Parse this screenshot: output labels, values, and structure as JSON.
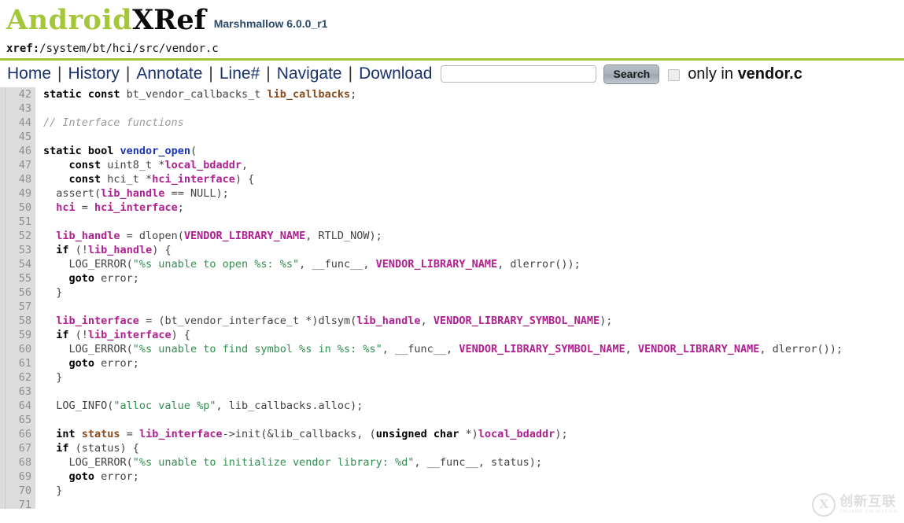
{
  "masthead": {
    "logo_part1": "Android",
    "logo_part2": "XRef",
    "version": "Marshmallow 6.0.0_r1",
    "brand_green": "#a4c639",
    "version_color": "#2c4a68"
  },
  "xref": {
    "label": "xref:",
    "path": "/system/bt/hci/src/vendor.c"
  },
  "nav": {
    "links": [
      {
        "label": "Home"
      },
      {
        "label": "History"
      },
      {
        "label": "Annotate"
      },
      {
        "label": "Line#"
      },
      {
        "label": "Navigate"
      },
      {
        "label": "Download"
      }
    ],
    "separator": "|",
    "search_value": "",
    "search_placeholder": "",
    "search_button_label": "Search",
    "only_in_prefix": "only in ",
    "only_in_file": "vendor.c",
    "only_in_checked": false
  },
  "code": {
    "first_line": 42,
    "last_line": 71,
    "lines": [
      {
        "n": "42",
        "tokens": [
          {
            "t": "kw",
            "v": "static const"
          },
          {
            "t": "pl",
            "v": " bt_vendor_callbacks_t "
          },
          {
            "t": "def",
            "v": "lib_callbacks"
          },
          {
            "t": "pl",
            "v": ";"
          }
        ]
      },
      {
        "n": "43",
        "tokens": []
      },
      {
        "n": "44",
        "tokens": [
          {
            "t": "cmt",
            "v": "// Interface functions"
          }
        ]
      },
      {
        "n": "45",
        "tokens": []
      },
      {
        "n": "46",
        "tokens": [
          {
            "t": "kw",
            "v": "static bool "
          },
          {
            "t": "fn",
            "v": "vendor_open"
          },
          {
            "t": "pl",
            "v": "("
          }
        ]
      },
      {
        "n": "47",
        "tokens": [
          {
            "t": "pl",
            "v": "    "
          },
          {
            "t": "kw",
            "v": "const"
          },
          {
            "t": "pl",
            "v": " uint8_t *"
          },
          {
            "t": "ref",
            "v": "local_bdaddr"
          },
          {
            "t": "pl",
            "v": ","
          }
        ]
      },
      {
        "n": "48",
        "tokens": [
          {
            "t": "pl",
            "v": "    "
          },
          {
            "t": "kw",
            "v": "const"
          },
          {
            "t": "pl",
            "v": " hci_t *"
          },
          {
            "t": "ref",
            "v": "hci_interface"
          },
          {
            "t": "pl",
            "v": ") {"
          }
        ]
      },
      {
        "n": "49",
        "tokens": [
          {
            "t": "pl",
            "v": "  assert("
          },
          {
            "t": "ref",
            "v": "lib_handle"
          },
          {
            "t": "pl",
            "v": " == NULL);"
          }
        ]
      },
      {
        "n": "50",
        "tokens": [
          {
            "t": "pl",
            "v": "  "
          },
          {
            "t": "ref",
            "v": "hci"
          },
          {
            "t": "pl",
            "v": " = "
          },
          {
            "t": "ref",
            "v": "hci_interface"
          },
          {
            "t": "pl",
            "v": ";"
          }
        ]
      },
      {
        "n": "51",
        "tokens": []
      },
      {
        "n": "52",
        "tokens": [
          {
            "t": "pl",
            "v": "  "
          },
          {
            "t": "ref",
            "v": "lib_handle"
          },
          {
            "t": "pl",
            "v": " = dlopen("
          },
          {
            "t": "ref",
            "v": "VENDOR_LIBRARY_NAME"
          },
          {
            "t": "pl",
            "v": ", RTLD_NOW);"
          }
        ]
      },
      {
        "n": "53",
        "tokens": [
          {
            "t": "pl",
            "v": "  "
          },
          {
            "t": "kw",
            "v": "if"
          },
          {
            "t": "pl",
            "v": " (!"
          },
          {
            "t": "ref",
            "v": "lib_handle"
          },
          {
            "t": "pl",
            "v": ") {"
          }
        ]
      },
      {
        "n": "54",
        "tokens": [
          {
            "t": "pl",
            "v": "    LOG_ERROR("
          },
          {
            "t": "str",
            "v": "\"%s unable to open %s: %s\""
          },
          {
            "t": "pl",
            "v": ", __func__, "
          },
          {
            "t": "ref",
            "v": "VENDOR_LIBRARY_NAME"
          },
          {
            "t": "pl",
            "v": ", dlerror());"
          }
        ]
      },
      {
        "n": "55",
        "tokens": [
          {
            "t": "pl",
            "v": "    "
          },
          {
            "t": "kw",
            "v": "goto"
          },
          {
            "t": "pl",
            "v": " error;"
          }
        ]
      },
      {
        "n": "56",
        "tokens": [
          {
            "t": "pl",
            "v": "  }"
          }
        ]
      },
      {
        "n": "57",
        "tokens": []
      },
      {
        "n": "58",
        "tokens": [
          {
            "t": "pl",
            "v": "  "
          },
          {
            "t": "ref",
            "v": "lib_interface"
          },
          {
            "t": "pl",
            "v": " = (bt_vendor_interface_t *)dlsym("
          },
          {
            "t": "ref",
            "v": "lib_handle"
          },
          {
            "t": "pl",
            "v": ", "
          },
          {
            "t": "ref",
            "v": "VENDOR_LIBRARY_SYMBOL_NAME"
          },
          {
            "t": "pl",
            "v": ");"
          }
        ]
      },
      {
        "n": "59",
        "tokens": [
          {
            "t": "pl",
            "v": "  "
          },
          {
            "t": "kw",
            "v": "if"
          },
          {
            "t": "pl",
            "v": " (!"
          },
          {
            "t": "ref",
            "v": "lib_interface"
          },
          {
            "t": "pl",
            "v": ") {"
          }
        ]
      },
      {
        "n": "60",
        "tokens": [
          {
            "t": "pl",
            "v": "    LOG_ERROR("
          },
          {
            "t": "str",
            "v": "\"%s unable to find symbol %s in %s: %s\""
          },
          {
            "t": "pl",
            "v": ", __func__, "
          },
          {
            "t": "ref",
            "v": "VENDOR_LIBRARY_SYMBOL_NAME"
          },
          {
            "t": "pl",
            "v": ", "
          },
          {
            "t": "ref",
            "v": "VENDOR_LIBRARY_NAME"
          },
          {
            "t": "pl",
            "v": ", dlerror());"
          }
        ]
      },
      {
        "n": "61",
        "tokens": [
          {
            "t": "pl",
            "v": "    "
          },
          {
            "t": "kw",
            "v": "goto"
          },
          {
            "t": "pl",
            "v": " error;"
          }
        ]
      },
      {
        "n": "62",
        "tokens": [
          {
            "t": "pl",
            "v": "  }"
          }
        ]
      },
      {
        "n": "63",
        "tokens": []
      },
      {
        "n": "64",
        "tokens": [
          {
            "t": "pl",
            "v": "  LOG_INFO("
          },
          {
            "t": "str",
            "v": "\"alloc value %p\""
          },
          {
            "t": "pl",
            "v": ", lib_callbacks.alloc);"
          }
        ]
      },
      {
        "n": "65",
        "tokens": []
      },
      {
        "n": "66",
        "tokens": [
          {
            "t": "kw",
            "v": "  int "
          },
          {
            "t": "def",
            "v": "status"
          },
          {
            "t": "pl",
            "v": " = "
          },
          {
            "t": "ref",
            "v": "lib_interface"
          },
          {
            "t": "pl",
            "v": "->init(&lib_callbacks, ("
          },
          {
            "t": "kw",
            "v": "unsigned char"
          },
          {
            "t": "pl",
            "v": " *)"
          },
          {
            "t": "ref",
            "v": "local_bdaddr"
          },
          {
            "t": "pl",
            "v": ");"
          }
        ]
      },
      {
        "n": "67",
        "tokens": [
          {
            "t": "pl",
            "v": "  "
          },
          {
            "t": "kw",
            "v": "if"
          },
          {
            "t": "pl",
            "v": " (status) {"
          }
        ]
      },
      {
        "n": "68",
        "tokens": [
          {
            "t": "pl",
            "v": "    LOG_ERROR("
          },
          {
            "t": "str",
            "v": "\"%s unable to initialize vendor library: %d\""
          },
          {
            "t": "pl",
            "v": ", __func__, status);"
          }
        ]
      },
      {
        "n": "69",
        "tokens": [
          {
            "t": "pl",
            "v": "    "
          },
          {
            "t": "kw",
            "v": "goto"
          },
          {
            "t": "pl",
            "v": " error;"
          }
        ]
      },
      {
        "n": "70",
        "tokens": [
          {
            "t": "pl",
            "v": "  }"
          }
        ]
      },
      {
        "n": "71",
        "tokens": []
      }
    ]
  },
  "watermark": {
    "mark": "X",
    "cn": "创新互联",
    "py": "CHUANG XIN HU LIAN"
  }
}
